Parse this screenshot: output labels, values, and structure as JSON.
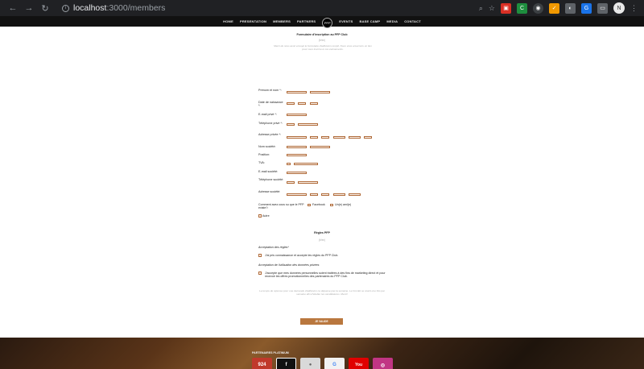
{
  "browser": {
    "url_host": "localhost",
    "url_path": ":3000/members",
    "profile_initial": "N"
  },
  "nav": {
    "items": [
      "HOME",
      "PRESENTATION",
      "MEMBERS",
      "PARTNERS",
      "EVENTS",
      "BASE CAMP",
      "MEDIA",
      "CONTACT"
    ]
  },
  "form": {
    "title": "Formulaire d'inscription au PFP Club",
    "intro_sub": "(fr/en)",
    "intro_text": "Merci de nous avoir envoyé le formulaire d'adhésion rempli. Nous vous enverrons un lien pour vous inscrire à nos événements.",
    "labels": {
      "name": "Prénom et nom *:",
      "birth": "Date de naissance *:",
      "email_private": "E-mail privé *:",
      "phone_private": "Téléphone privé *:",
      "address_private": "Adresse privée *:",
      "company": "Nom société:",
      "position": "Position:",
      "tva": "TVA:",
      "email_company": "E-mail société:",
      "phone_company": "Téléphone société:",
      "address_company": "Adresse société:",
      "how_known": "Comment avez-vous su que le PFP existe?:"
    },
    "options": {
      "facebook": "Facebook",
      "friend": "Un(e) ami(e)",
      "other": "Autre"
    }
  },
  "rules": {
    "title": "Règles PFP",
    "sub": "(fr/en)",
    "accept_heading": "Acceptation des règles*",
    "accept_text": "J'ai pris connaissance et accepte les règles du PFP Club.",
    "data_heading": "Acceptation de l'utilisation des données privées",
    "data_text": "J'accepte que mes données personnelles soient traitées à des fins de marketing direct et pour recevoir les offres promotionnelles des partenaires du PFP Club.",
    "note": "Le temps de réponse pour une demande d'adhésion ne dépasse pas la semaine. Le Comité se réunit une fois par semaine afin d'étudier les candidatures. Merci!",
    "submit": "JE VALIDE"
  },
  "footer": {
    "title": "PARTENAIRES PLATINIUM",
    "tiles": [
      {
        "label": "924",
        "color": "#c0392b"
      },
      {
        "label": "f",
        "color": "#111111"
      },
      {
        "label": "",
        "color": "#d9d9d9"
      },
      {
        "label": "G",
        "color": "#f2f2f2"
      },
      {
        "label": "You",
        "color": "#e00000"
      },
      {
        "label": "◎",
        "color": "#c13584"
      }
    ]
  }
}
